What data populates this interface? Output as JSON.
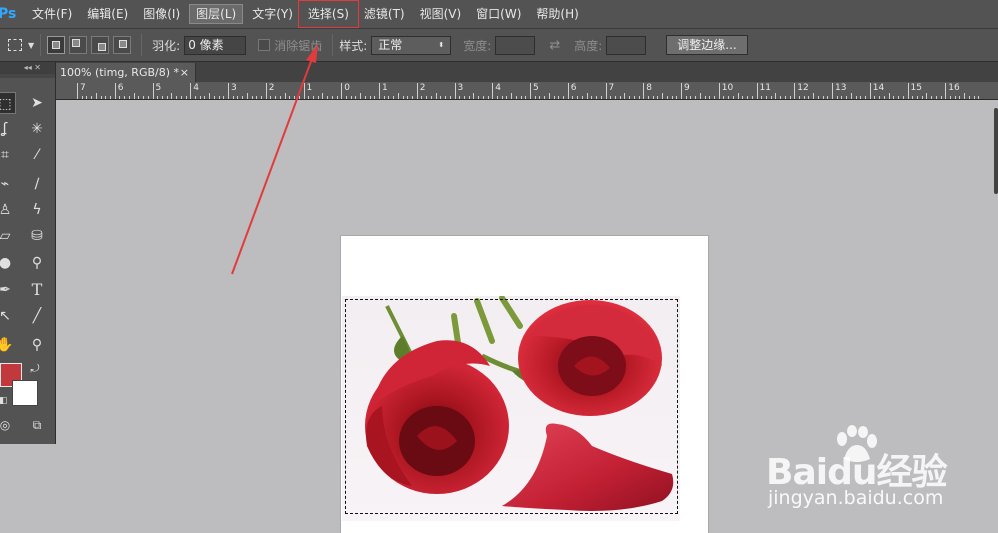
{
  "app": {
    "logo": "Ps"
  },
  "menu": [
    {
      "label": "文件(F)"
    },
    {
      "label": "编辑(E)"
    },
    {
      "label": "图像(I)"
    },
    {
      "label": "图层(L)"
    },
    {
      "label": "文字(Y)"
    },
    {
      "label": "选择(S)"
    },
    {
      "label": "滤镜(T)"
    },
    {
      "label": "视图(V)"
    },
    {
      "label": "窗口(W)"
    },
    {
      "label": "帮助(H)"
    }
  ],
  "options": {
    "feather_label": "羽化:",
    "feather_value": "0 像素",
    "antialias_label": "消除锯齿",
    "style_label": "样式:",
    "style_value": "正常",
    "width_label": "宽度:",
    "height_label": "高度:",
    "refine_button": "调整边缘..."
  },
  "document": {
    "tab_title": "100% (timg, RGB/8) *",
    "close": "×"
  },
  "ruler": [
    "7",
    "6",
    "5",
    "4",
    "3",
    "2",
    "1",
    "0",
    "1",
    "2",
    "3",
    "4",
    "5",
    "6",
    "7",
    "8",
    "9",
    "10",
    "11",
    "12",
    "13",
    "14",
    "15",
    "16"
  ],
  "tools": {
    "type_tool_glyph": "T"
  },
  "colors": {
    "foreground": "#c1393d",
    "background": "#ffffff",
    "annotation": "#e23b3b"
  },
  "watermark": {
    "text": "Baidu经验",
    "url": "jingyan.baidu.com"
  }
}
